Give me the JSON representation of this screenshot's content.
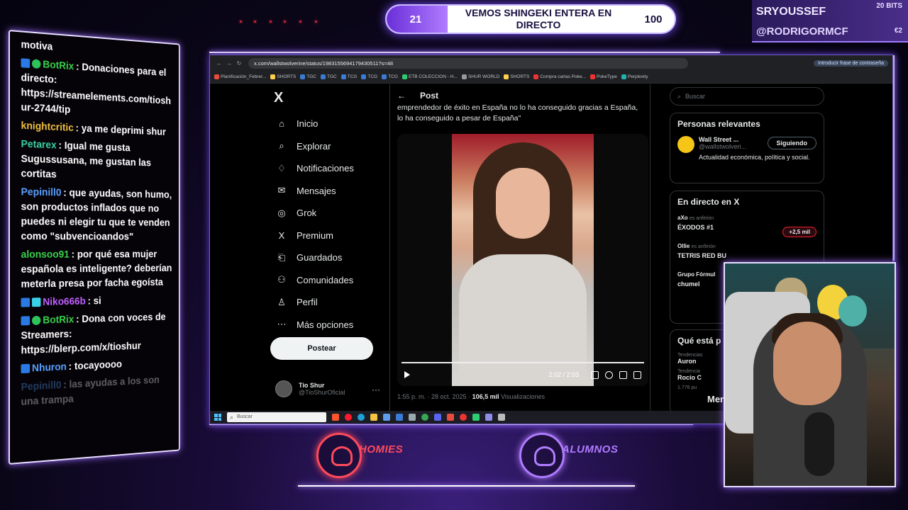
{
  "banner": {
    "left_num": "21",
    "title": "VEMOS SHINGEKI ENTERA EN DIRECTO",
    "right_num": "100",
    "progress": 0.21
  },
  "alerts": {
    "user1": "SRYOUSSEF",
    "bits1": "20 BITS",
    "user2": "@RODRIGORMCF",
    "bits2": "€2"
  },
  "chat": {
    "messages": [
      {
        "user": "",
        "user_color": "#ffffff",
        "badges": [],
        "text": "motiva"
      },
      {
        "user": "BotRix",
        "user_color": "#3ad04a",
        "badges": [
          "blue",
          "green"
        ],
        "text": ": Donaciones para el directo: https://streamelements.com/tioshur-2744/tip"
      },
      {
        "user": "knightcritic",
        "user_color": "#f0c040",
        "badges": [],
        "text": ": ya me deprimi shur"
      },
      {
        "user": "Petarex",
        "user_color": "#3ad0a0",
        "badges": [],
        "text": ": Igual me gusta Sugussusana, me gustan las cortitas"
      },
      {
        "user": "Pepinill0",
        "user_color": "#5aa0ff",
        "badges": [],
        "text": ": que ayudas, son humo, son productos inflados que no puedes ni elegir tu que te venden como \"subvencioandos\""
      },
      {
        "user": "alonsoo91",
        "user_color": "#3ad04a",
        "badges": [],
        "text": ": por qué esa mujer española es inteligente? deberían meterla presa por facha egoísta"
      },
      {
        "user": "Niko666b",
        "user_color": "#c060ff",
        "badges": [
          "blue",
          "cyan"
        ],
        "text": ": si"
      },
      {
        "user": "BotRix",
        "user_color": "#3ad04a",
        "badges": [
          "blue",
          "green"
        ],
        "text": ": Dona con voces de Streamers: https://blerp.com/x/tioshur"
      },
      {
        "user": "Nhuron",
        "user_color": "#5aa0ff",
        "badges": [
          "blue"
        ],
        "text": ": tocayoooo"
      },
      {
        "user": "Pepinill0",
        "user_color": "#5aa0ff",
        "badges": [],
        "text": ": las ayudas a los son una trampa"
      }
    ]
  },
  "browser": {
    "url": "x.com/wallstwolverine/status/1983155694179430511?s=48",
    "ext_button": "Introducir frase de contraseña",
    "bookmarks": [
      "Planificación_Febrer...",
      "SHORTS",
      "TGC",
      "TGC",
      "TCG",
      "TCG",
      "TCG",
      "ETB COLECCION - H...",
      "SHUR WORLD",
      "SHORTS",
      "Compra cartas Poke...",
      "PokeType",
      "Perplexity"
    ]
  },
  "xnav": {
    "logo": "X",
    "items": [
      {
        "icon": "home-icon",
        "label": "Inicio"
      },
      {
        "icon": "search-icon",
        "label": "Explorar"
      },
      {
        "icon": "bell-icon",
        "label": "Notificaciones"
      },
      {
        "icon": "mail-icon",
        "label": "Mensajes"
      },
      {
        "icon": "grok-icon",
        "label": "Grok"
      },
      {
        "icon": "x-premium-icon",
        "label": "Premium"
      },
      {
        "icon": "bookmark-icon",
        "label": "Guardados"
      },
      {
        "icon": "communities-icon",
        "label": "Comunidades"
      },
      {
        "icon": "person-icon",
        "label": "Perfil"
      },
      {
        "icon": "more-icon",
        "label": "Más opciones"
      }
    ],
    "post_button": "Postear",
    "profile_name": "Tio Shur",
    "profile_handle": "@TioShurOficial"
  },
  "post": {
    "header": "Post",
    "text": "emprendedor de éxito en España no lo ha conseguido gracias a España, lo ha conseguido a pesar de España\"",
    "time": "2:02 / 2:03",
    "meta_date": "1:55 p. m. · 28 oct. 2025 · ",
    "meta_views": "106,5 mil",
    "meta_views_label": " Visualizaciones"
  },
  "right": {
    "search_placeholder": "Buscar",
    "relevant_title": "Personas relevantes",
    "relevant_name": "Wall Street ...",
    "relevant_handle": "@wallstwolveri...",
    "relevant_bio": "Actualidad económica, política y social.",
    "follow_label": "Siguiendo",
    "live_title": "En directo en X",
    "lives": [
      {
        "host": "aXo",
        "host_label": "es anfitrión",
        "title": "ÉXODOS #1"
      },
      {
        "host": "Ollie",
        "host_label": "es anfitrión",
        "title": "TETRIS RED BU"
      },
      {
        "host": "Grupo Fórmul",
        "host_label": "",
        "title": "chumel"
      }
    ],
    "live_pill": "+2,5 mil",
    "trending_title": "Qué está p",
    "trends": [
      {
        "label": "Tendencias",
        "topic": "Auron"
      },
      {
        "label": "Tendencia",
        "topic": "Rocío C"
      }
    ],
    "trend_count": "1.776 pu"
  },
  "taskbar": {
    "search_placeholder": "Buscar"
  },
  "webcam": {
    "tag": "Men"
  },
  "logos": {
    "left": "HOMIES",
    "right": "ALUMNOS"
  },
  "colors": {
    "accent": "#9d6bff",
    "homies": "#ff4a5c",
    "alumnos": "#b07bff"
  }
}
